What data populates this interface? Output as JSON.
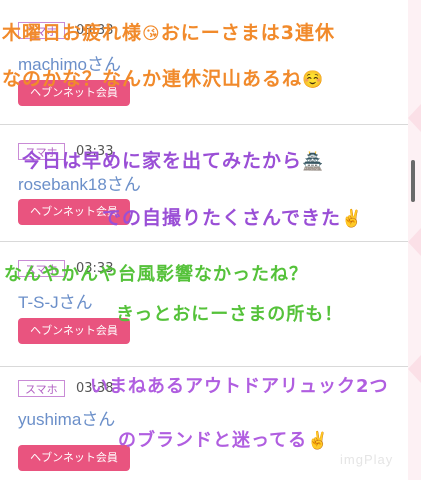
{
  "posts": [
    {
      "device": "スマホ",
      "time": "03:33",
      "username": "machimoさん",
      "member_label": "ヘブンネット会員"
    },
    {
      "device": "スマホ",
      "time": "03:33",
      "username": "rosebank18さん",
      "member_label": "ヘブンネット会員"
    },
    {
      "device": "スマホ",
      "time": "03:33",
      "username": "T-S-Jさん",
      "member_label": "ヘブンネット会員"
    },
    {
      "device": "スマホ",
      "time": "03:38",
      "username": "yushimaさん",
      "member_label": "ヘブンネット会員"
    }
  ],
  "overlay_text": {
    "line1": "木曜日お疲れ様",
    "line1_emoji": "😘",
    "line1_rest": "おにーさまは3連休",
    "line2": "なのかな？なんか連休沢山あるね",
    "line2_emoji": "☺️",
    "line3": "今日は早めに家を出てみたから",
    "line3_emoji": "🏯",
    "line4": "での自撮りたくさんできた",
    "line4_emoji": "✌️",
    "line5": "なんやかんや台風影響なかったね？",
    "line6": "きっとおにーさまの所も！",
    "line7": "いまねあるアウトドアリュック2つ",
    "line8": "のブランドと迷ってる",
    "line8_emoji": "✌️"
  },
  "watermark": "imgPlay",
  "colors": {
    "member_button": "#e9547f",
    "device_tag": "#b160c2",
    "username": "#6b8fc9",
    "overlay_orange": "#f18a2b",
    "overlay_purple": "#9a4fd6",
    "overlay_green": "#55c23a",
    "overlay_violet": "#b05ee0"
  }
}
